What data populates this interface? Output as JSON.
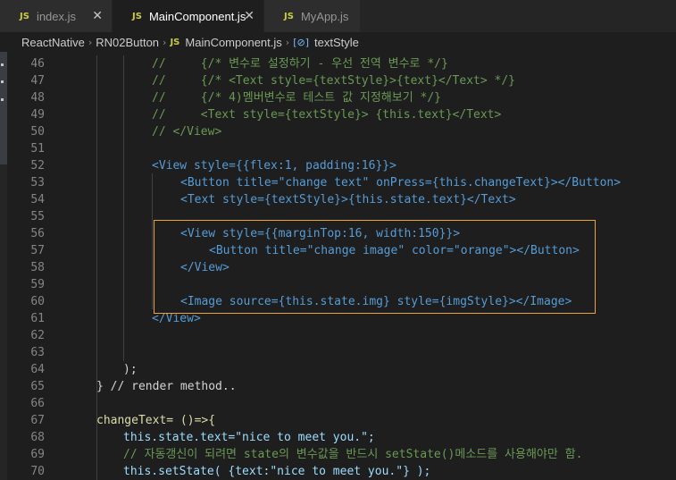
{
  "tabs": [
    {
      "label": "index.js",
      "badge": "JS",
      "active": false,
      "close": "✕"
    },
    {
      "label": "MainComponent.js",
      "badge": "JS",
      "active": true,
      "close": "✕"
    },
    {
      "label": "MyApp.js",
      "badge": "JS",
      "active": false,
      "close": ""
    }
  ],
  "breadcrumb": {
    "items": [
      "ReactNative",
      "RN02Button",
      "MainComponent.js",
      "textStyle"
    ],
    "file_badge": "JS",
    "symbol_badge": "[⊘]"
  },
  "lines": [
    {
      "num": "46",
      "text": "//     {/* 변수로 설정하기 - 우선 전역 변수로 */}"
    },
    {
      "num": "47",
      "text": "//     {/* <Text style={textStyle}>{text}</Text> */}"
    },
    {
      "num": "48",
      "text": "//     {/* 4)멤버변수로 테스트 값 지정해보기 */}"
    },
    {
      "num": "49",
      "text": "//     <Text style={textStyle}> {this.text}</Text>"
    },
    {
      "num": "50",
      "text": "// </View>"
    },
    {
      "num": "51",
      "text": ""
    },
    {
      "num": "52",
      "text": "<View style={{flex:1, padding:16}}>"
    },
    {
      "num": "53",
      "text": "<Button title=\"change text\" onPress={this.changeText}></Button>"
    },
    {
      "num": "54",
      "text": "<Text style={textStyle}>{this.state.text}</Text>"
    },
    {
      "num": "55",
      "text": ""
    },
    {
      "num": "56",
      "text": "<View style={{marginTop:16, width:150}}>"
    },
    {
      "num": "57",
      "text": "<Button title=\"change image\" color=\"orange\"></Button>"
    },
    {
      "num": "58",
      "text": "</View>"
    },
    {
      "num": "59",
      "text": ""
    },
    {
      "num": "60",
      "text": "<Image source={this.state.img} style={imgStyle}></Image>"
    },
    {
      "num": "61",
      "text": "</View>"
    },
    {
      "num": "62",
      "text": ""
    },
    {
      "num": "63",
      "text": ""
    },
    {
      "num": "64",
      "text": ");"
    },
    {
      "num": "65",
      "text": "} // render method.."
    },
    {
      "num": "66",
      "text": ""
    },
    {
      "num": "67",
      "text": "changeText= ()=>{"
    },
    {
      "num": "68",
      "text": "this.state.text=\"nice to meet you.\";"
    },
    {
      "num": "69",
      "text": "// 자동갱신이 되려면 state의 변수값을 반드시 setState()메소드를 사용해야만 함."
    },
    {
      "num": "70",
      "text": "this.setState( {text:\"nice to meet you.\"} );"
    }
  ],
  "colors": {
    "highlight_box": "#e8a33d",
    "comment": "#6a9955",
    "tag": "#569cd6",
    "attribute": "#9cdcfe",
    "string": "#ce9178",
    "function": "#dcdcaa"
  }
}
